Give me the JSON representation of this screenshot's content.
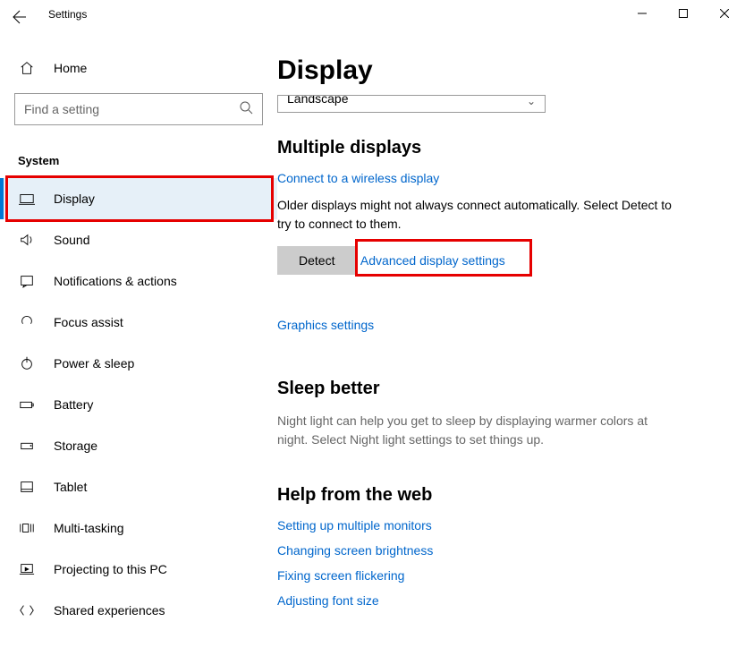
{
  "app_title": "Settings",
  "controls": {
    "minimize": "—",
    "maximize": "☐",
    "close": "✕"
  },
  "sidebar": {
    "home_label": "Home",
    "search_placeholder": "Find a setting",
    "category": "System",
    "items": [
      {
        "label": "Display",
        "active": true
      },
      {
        "label": "Sound"
      },
      {
        "label": "Notifications & actions"
      },
      {
        "label": "Focus assist"
      },
      {
        "label": "Power & sleep"
      },
      {
        "label": "Battery"
      },
      {
        "label": "Storage"
      },
      {
        "label": "Tablet"
      },
      {
        "label": "Multi-tasking"
      },
      {
        "label": "Projecting to this PC"
      },
      {
        "label": "Shared experiences"
      }
    ]
  },
  "content": {
    "title": "Display",
    "orientation_value": "Landscape",
    "sec1": {
      "title": "Multiple displays",
      "link1": "Connect to a wireless display",
      "para": "Older displays might not always connect automatically. Select Detect to try to connect to them.",
      "detect": "Detect",
      "link2": "Advanced display settings",
      "link3": "Graphics settings"
    },
    "sec2": {
      "title": "Sleep better",
      "para": "Night light can help you get to sleep by displaying warmer colors at night. Select Night light settings to set things up."
    },
    "sec3": {
      "title": "Help from the web",
      "links": [
        "Setting up multiple monitors",
        "Changing screen brightness",
        "Fixing screen flickering",
        "Adjusting font size"
      ]
    }
  }
}
